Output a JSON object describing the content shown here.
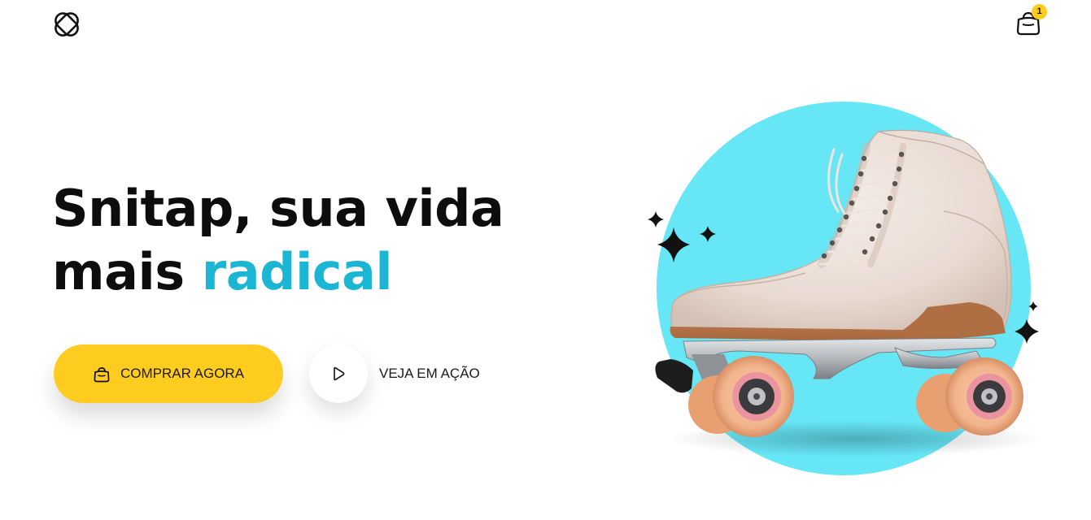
{
  "header": {
    "logo_icon": "snitap-logo-icon",
    "cart_icon": "shopping-bag-icon",
    "cart_count": "1"
  },
  "hero": {
    "title_line1": "Snitap, sua vida",
    "title_line2_plain": "mais",
    "title_line2_accent": "radical",
    "buy_label": "COMPRAR AGORA",
    "buy_icon": "shopping-bag-icon",
    "watch_label": "VEJA EM AÇÃO",
    "watch_icon": "play-icon",
    "image_subject": "roller-skate-image"
  },
  "colors": {
    "accent": "#1AB6D4",
    "button_yellow": "#FFCC1F",
    "circle_cyan": "#67E6F6",
    "text_dark": "#0d0d0d"
  }
}
